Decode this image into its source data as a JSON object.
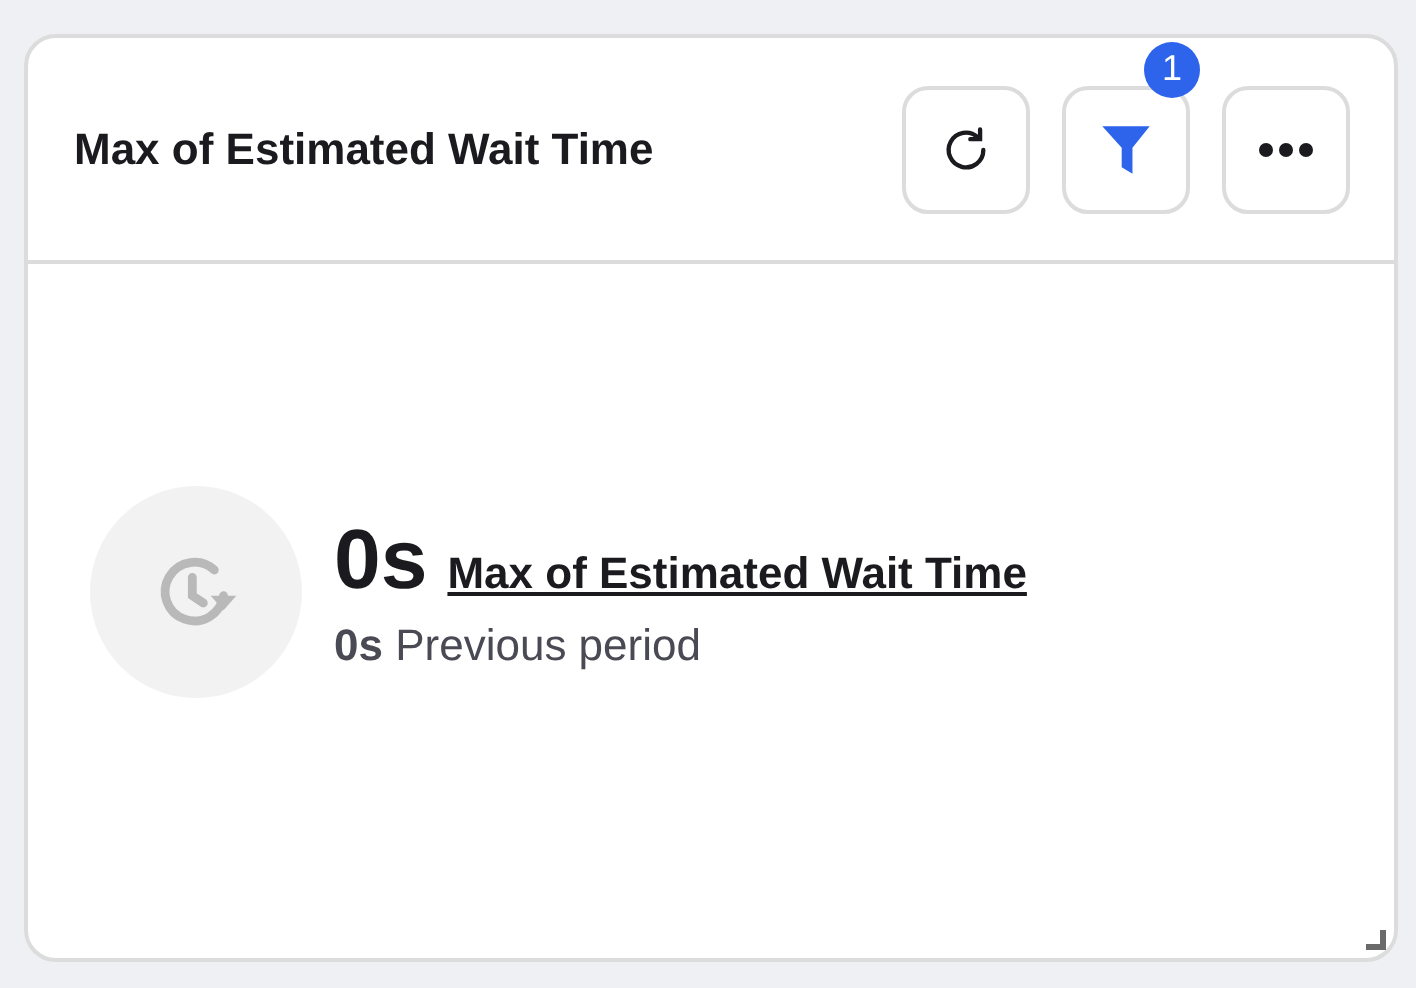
{
  "card": {
    "title": "Max of Estimated Wait Time",
    "actions": [
      {
        "kind": "refresh"
      },
      {
        "kind": "filter",
        "badge": "1"
      },
      {
        "kind": "more"
      }
    ],
    "metric": {
      "value": "0s",
      "label": "Max of Estimated Wait Time",
      "comparison": "**0s** Previous period"
    }
  }
}
